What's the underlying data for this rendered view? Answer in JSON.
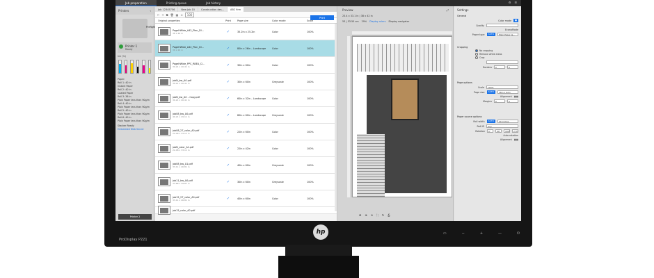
{
  "topbar": {
    "tabs": [
      "Job preparation",
      "Printing queue",
      "Job history"
    ]
  },
  "left": {
    "title": "Printers",
    "printer_label": "Prefight",
    "printer_name": "Printer 1",
    "printer_status": "Ready",
    "ink_label": "Ink (%)",
    "paper_title": "Paper:",
    "rolls": [
      "Roll 1: 40 in",
      "Instant Paper",
      "Roll 2: 40 in",
      "Coated Paper",
      "Roll 3: 36 in",
      "Plain Paper less than 90g/m",
      "Roll 4: 40 in",
      "Plain Paper less than 90g/m",
      "Roll 5: 40 in",
      "Plain Paper less than 90g/m",
      "Roll 6: 40 in",
      "Plain Paper less than 90g/m"
    ],
    "stacker": "Stacker Ready",
    "web_server": "Embedded Web Server",
    "printer2": "Printer 2",
    "inks": [
      {
        "color": "#00aeef",
        "level": 0.7
      },
      {
        "color": "#e4007c",
        "level": 0.6
      },
      {
        "color": "#ffd200",
        "level": 0.8
      },
      {
        "color": "#111111",
        "level": 0.5
      },
      {
        "color": "#ec008c",
        "level": 0.6
      },
      {
        "color": "#fff200",
        "level": 0.4
      }
    ]
  },
  "center": {
    "tabs": [
      "Job 12345756",
      "New Job 10",
      "Construction des...",
      "ABC firm"
    ],
    "print_label": "Print",
    "zoom": "100",
    "headers": [
      "Original properties",
      "Print",
      "Page size",
      "Color mode",
      "Scale"
    ],
    "rows": [
      {
        "name": "PageHWide_A42_Plan_Dl...",
        "size": "36 x 26 in",
        "page": "35.2in x 25.2in",
        "mode": "Color",
        "scale": "100%",
        "selected": false
      },
      {
        "name": "PageHWide_A42_Plan_Dl...",
        "size": "36 x 26 in",
        "page": "80in x 26in – Landscape",
        "mode": "Color",
        "scale": "100%",
        "selected": true
      },
      {
        "name": "PageHWide_PPC_RBEA_Cl...",
        "size": "30.21 x 40.41 in",
        "page": "30in x 60in",
        "mode": "Color",
        "scale": "100%",
        "selected": false
      },
      {
        "name": "jobN_bw_A0.pdf",
        "size": "30.21 x 40.41 in",
        "page": "30in x 60in",
        "mode": "Greyscale",
        "scale": "100%",
        "selected": false
      },
      {
        "name": "jobN_bw_A0 – Copy.pdf",
        "size": "30.21 x 40.41 in",
        "page": "60in x 32in – Landscape",
        "mode": "Color",
        "scale": "100%",
        "selected": false
      },
      {
        "name": "job08_bw_A0.pdf",
        "size": "40.21 x 29.11 in",
        "page": "80in x 60in – Landscape",
        "mode": "Greyscale",
        "scale": "100%",
        "selected": false
      },
      {
        "name": "job08_27_color_A0.pdf",
        "size": "22.48 x 33.11 in",
        "page": "22in x 60in",
        "mode": "Color",
        "scale": "100%",
        "selected": false
      },
      {
        "name": "jobN_color_A1.pdf",
        "size": "22.48 x 33.11 in",
        "page": "22in x 42in",
        "mode": "Color",
        "scale": "100%",
        "selected": false
      },
      {
        "name": "job08_bw_A1.pdf",
        "size": "33.11 x 46.81 in",
        "page": "40in x 60in",
        "mode": "Greyscale",
        "scale": "100%",
        "selected": false
      },
      {
        "name": "job11_bw_A0.pdf",
        "size": "33.88 x 39.87 in",
        "page": "30in x 60in",
        "mode": "Greyscale",
        "scale": "100%",
        "selected": false
      },
      {
        "name": "job15_27_color_A0.pdf",
        "size": "33.11 x 46.81 in",
        "page": "40in x 60in",
        "mode": "Color",
        "scale": "100%",
        "selected": false
      },
      {
        "name": "job15_color_A0.pdf",
        "size": "",
        "page": "",
        "mode": "",
        "scale": "",
        "selected": false
      }
    ]
  },
  "preview": {
    "title": "Preview",
    "dims": "23.4 x 33.1 in  |  38 x 42 in",
    "ruler": "53 | 53.50 cm",
    "zoom": "29%",
    "show_rulers": "Display rulers",
    "display_navigator": "Display navigator"
  },
  "settings": {
    "title": "Settings",
    "general": "General",
    "color_mode": "Color mode",
    "quality": "Quality",
    "economode": "EconoMode",
    "paper_type": "Paper type",
    "paper_type_val": "Plain Paper la...",
    "auto": "AUTO",
    "cropping": "Cropping",
    "crop_opts": [
      "No cropping",
      "Remove white areas",
      "Crop"
    ],
    "borders": "Borders",
    "page_options": "Page options",
    "scale": "Scale",
    "scale_val": "100%",
    "page_size": "Page size",
    "page_size_val": "36in x 62in",
    "alignment": "Alignment",
    "margins": "Margins",
    "paper_source": "Paper source options",
    "roll_width": "Roll width",
    "roll_width_val": "40 inches",
    "roll_id": "Roll ID",
    "roll_id_val": "Any",
    "rotation": "Rotation",
    "rot_vals": [
      "0°",
      "90°",
      "180°",
      "270°"
    ],
    "auto_rotation": "Auto rotation",
    "alignment2": "Alignment",
    "zero": "0"
  },
  "monitor": {
    "brand": "ProDisplay P221",
    "logo": "hp"
  }
}
